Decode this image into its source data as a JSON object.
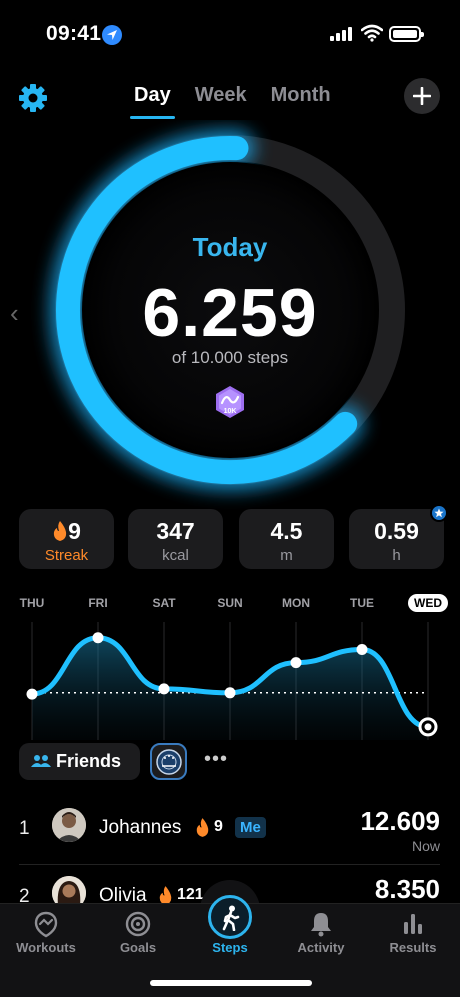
{
  "status": {
    "time": "09:41"
  },
  "header": {
    "tabs": [
      {
        "label": "Day",
        "active": true
      },
      {
        "label": "Week"
      },
      {
        "label": "Month"
      }
    ]
  },
  "summary": {
    "title": "Today",
    "steps": "6.259",
    "goal_text": "of 10.000 steps",
    "badge": "10K",
    "progress": 0.6259
  },
  "stats": [
    {
      "value": "9",
      "label": "Streak"
    },
    {
      "value": "347",
      "label": "kcal"
    },
    {
      "value": "4.5",
      "label": "m"
    },
    {
      "value": "0.59",
      "label": "h"
    }
  ],
  "chart_data": {
    "type": "line",
    "categories": [
      "THU",
      "FRI",
      "SAT",
      "SUN",
      "MON",
      "TUE",
      "WED"
    ],
    "current": "WED",
    "values": [
      5500,
      9800,
      5900,
      5600,
      7900,
      8900,
      3000
    ],
    "goal_line": 5600
  },
  "friends": {
    "button_label": "Friends",
    "more": "•••",
    "rows": [
      {
        "rank": "1",
        "name": "Johannes",
        "streak": "9",
        "me": "Me",
        "steps": "12.609",
        "sub": "Now"
      },
      {
        "rank": "2",
        "name": "Olivia",
        "streak": "121",
        "steps": "8.350"
      }
    ]
  },
  "tabbar": [
    {
      "label": "Workouts",
      "icon": "workouts-icon"
    },
    {
      "label": "Goals",
      "icon": "target-icon"
    },
    {
      "label": "Steps",
      "icon": "walking-icon",
      "active": true
    },
    {
      "label": "Activity",
      "icon": "bell-icon"
    },
    {
      "label": "Results",
      "icon": "bar-chart-icon"
    }
  ],
  "colors": {
    "accent": "#27b6f2",
    "flame": "#ff8a2a"
  }
}
